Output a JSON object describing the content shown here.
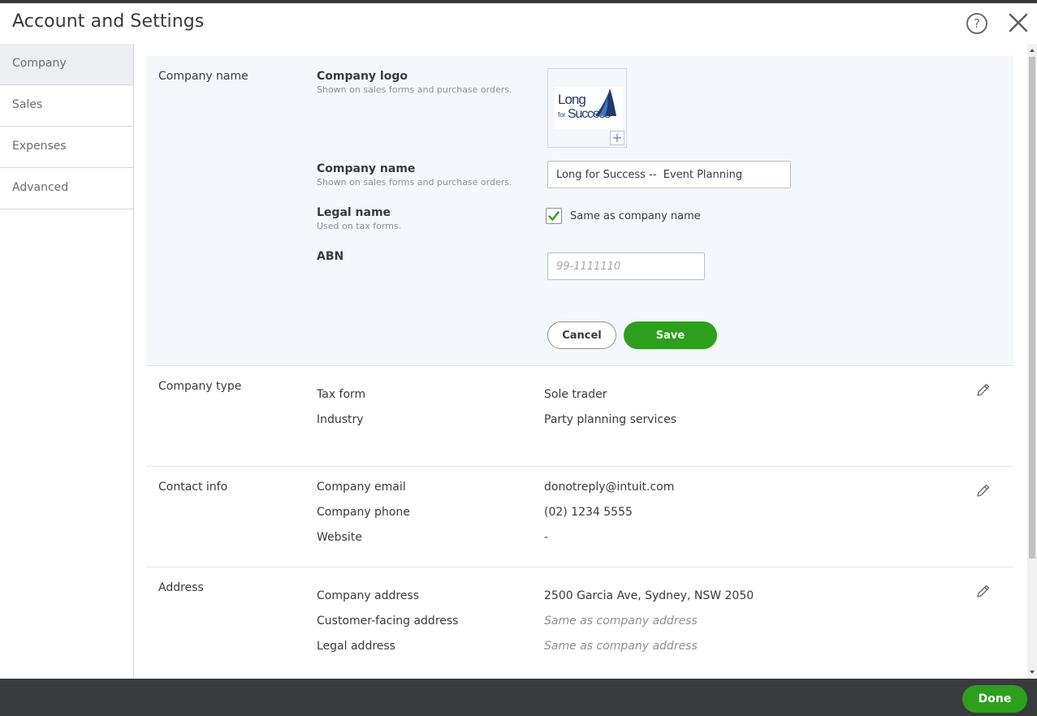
{
  "header": {
    "title": "Account and Settings",
    "help_glyph": "?"
  },
  "sidebar": {
    "items": [
      {
        "label": "Company"
      },
      {
        "label": "Sales"
      },
      {
        "label": "Expenses"
      },
      {
        "label": "Advanced"
      }
    ]
  },
  "company_name_section": {
    "label": "Company name",
    "logo": {
      "label": "Company logo",
      "sub": "Shown on sales forms and purchase orders.",
      "logo_text_long": "Long",
      "logo_text_for": "for",
      "logo_text_success": "Success",
      "add_glyph": "+"
    },
    "company_name": {
      "label": "Company name",
      "sub": "Shown on sales forms and purchase orders.",
      "value": "Long for Success --  Event Planning"
    },
    "legal_name": {
      "label": "Legal name",
      "sub": "Used on tax forms.",
      "checkbox_label": "Same as company name",
      "checked": true
    },
    "abn": {
      "label": "ABN",
      "placeholder": "99-1111110"
    },
    "cancel_label": "Cancel",
    "save_label": "Save"
  },
  "company_type_section": {
    "label": "Company type",
    "rows": [
      {
        "label": "Tax form",
        "value": "Sole trader"
      },
      {
        "label": "Industry",
        "value": "Party planning services"
      }
    ]
  },
  "contact_info_section": {
    "label": "Contact info",
    "rows": [
      {
        "label": "Company email",
        "value": "donotreply@intuit.com"
      },
      {
        "label": "Company phone",
        "value": "(02) 1234 5555"
      },
      {
        "label": "Website",
        "value": "-"
      }
    ]
  },
  "address_section": {
    "label": "Address",
    "rows": [
      {
        "label": "Company address",
        "value": "2500 Garcia Ave, Sydney, NSW 2050"
      },
      {
        "label": "Customer-facing address",
        "value": "Same as company address"
      },
      {
        "label": "Legal address",
        "value": "Same as company address"
      }
    ]
  },
  "footer": {
    "done_label": "Done"
  },
  "colors": {
    "accent_green": "#2ca01c",
    "footer_dark": "#393a3d",
    "highlight_bg": "#f4f8fc",
    "logo_navy": "#1f3a6e",
    "logo_blue": "#3a7bc8"
  },
  "icons": {
    "help": "help-circle-icon",
    "close": "close-icon",
    "edit": "pencil-icon",
    "check": "checkmark-icon",
    "add": "plus-icon"
  }
}
